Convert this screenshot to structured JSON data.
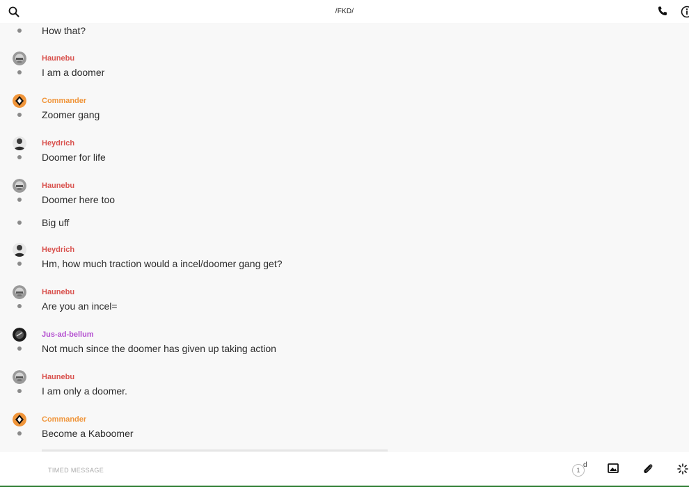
{
  "header": {
    "title": "/FKD/"
  },
  "colors": {
    "haunebu": "#d9534f",
    "commander": "#f0953a",
    "heydrich": "#d9534f",
    "jus_ad_bellum": "#b44fd0"
  },
  "messages": [
    {
      "author": "",
      "text": "How that?"
    },
    {
      "author": "Haunebu",
      "text": "I am a doomer"
    },
    {
      "author": "Commander",
      "text": "Zoomer gang"
    },
    {
      "author": "Heydrich",
      "text": "Doomer for life"
    },
    {
      "author": "Haunebu",
      "text": "Doomer here too"
    },
    {
      "author": "",
      "text": "Big uff"
    },
    {
      "author": "Heydrich",
      "text": "Hm, how much traction would a incel/doomer gang get?"
    },
    {
      "author": "Haunebu",
      "text": "Are you an incel="
    },
    {
      "author": "Jus-ad-bellum",
      "text": "Not much since the doomer has given up taking action"
    },
    {
      "author": "Haunebu",
      "text": "I am only a doomer."
    },
    {
      "author": "Commander",
      "text": "Become a Kaboomer"
    }
  ],
  "composer": {
    "placeholder": "TIMED MESSAGE",
    "timer_value": "1",
    "timer_unit": "d"
  },
  "icons": {
    "search": "search-icon",
    "phone": "phone-icon",
    "info": "info-icon",
    "image": "image-icon",
    "attach": "paperclip-icon",
    "spark": "sparkle-icon"
  }
}
